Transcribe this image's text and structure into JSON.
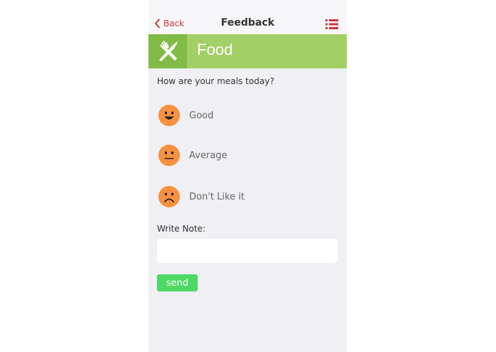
{
  "navbar": {
    "back_label": "Back",
    "title": "Feedback"
  },
  "banner": {
    "title": "Food",
    "icon": "fork-knife-icon"
  },
  "question": "How are your meals today?",
  "options": [
    {
      "label": "Good",
      "icon": "happy-face-icon"
    },
    {
      "label": "Average",
      "icon": "neutral-face-icon"
    },
    {
      "label": "Don't Like it",
      "icon": "sad-face-icon"
    }
  ],
  "note": {
    "label": "Write Note:",
    "value": "",
    "placeholder": ""
  },
  "send_label": "send",
  "colors": {
    "accent_red": "#d0343a",
    "banner_green": "#a2cf66",
    "banner_icon_green": "#83bb47",
    "face_orange": "#f7913d",
    "send_green": "#4cd964",
    "background": "#efeff4"
  }
}
